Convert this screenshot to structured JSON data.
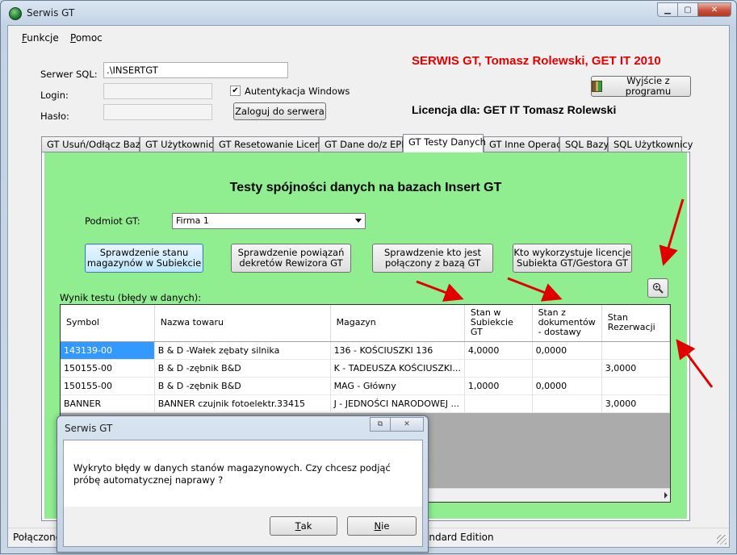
{
  "window": {
    "title": "Serwis GT",
    "controls": [
      "▁",
      "▢",
      "✕"
    ]
  },
  "menu": [
    {
      "accel": "F",
      "rest": "unkcje"
    },
    {
      "accel": "P",
      "rest": "omoc"
    }
  ],
  "connection": {
    "server_label": "Serwer SQL:",
    "server_value": ".\\INSERTGT",
    "login_label": "Login:",
    "login_value": "",
    "password_label": "Hasło:",
    "password_value": "",
    "windows_auth_label": "Autentykacja Windows",
    "windows_auth_checked": true,
    "connect_button": "Zaloguj do serwera"
  },
  "header": {
    "title": "SERWIS GT, Tomasz Rolewski, GET IT 2010",
    "license": "Licencja dla: GET IT Tomasz Rolewski",
    "exit_button": "Wyjście z programu",
    "title_color": "#e30000"
  },
  "tabs": [
    "GT Usuń/Odłącz Bazy",
    "GT Użytkownicy",
    "GT Resetowanie Licencji",
    "GT Dane do/z EPP",
    "GT Testy Danych",
    "GT Inne Operacje",
    "SQL Bazy",
    "SQL Użytkownicy"
  ],
  "active_tab": "GT Testy Danych",
  "panel": {
    "heading": "Testy spójności danych na bazach Insert GT",
    "subject_label": "Podmiot GT:",
    "subject_value": "Firma 1",
    "buttons": [
      "Sprawdzenie stanu magazynów w Subiekcie",
      "Sprawdzenie powiązań dekretów Rewizora GT",
      "Sprawdzenie kto jest połączony z bazą GT",
      "Kto wykorzystuje licencje Subiekta GT/Gestora GT"
    ],
    "result_label": "Wynik testu (błędy w danych):",
    "background_color": "#90ee90"
  },
  "grid": {
    "columns": [
      "Symbol",
      "Nazwa towaru",
      "Magazyn",
      "Stan w Subiekcie GT",
      "Stan z dokumentów - dostawy",
      "Stan Rezerwacji"
    ],
    "rows": [
      [
        "143139-00",
        "B & D -Wałek zębaty silnika",
        "136 - KOŚCIUSZKI  136",
        "4,0000",
        "0,0000",
        ""
      ],
      [
        "150155-00",
        "B & D -zębnik B&D",
        "K - TADEUSZA KOŚCIUSZKI...",
        "",
        "",
        "3,0000"
      ],
      [
        "150155-00",
        "B & D -zębnik B&D",
        "MAG - Główny",
        "1,0000",
        "0,0000",
        ""
      ],
      [
        "BANNER",
        "BANNER czujnik fotoelektr.33415",
        "J - JEDNOŚCI NARODOWEJ ...",
        "",
        "",
        "3,0000"
      ]
    ]
  },
  "status": {
    "left": "Połączono",
    "right": "andard Edition"
  },
  "dialog": {
    "title": "Serwis GT",
    "message": "Wykryto błędy w danych stanów magazynowych. Czy chcesz podjąć próbę automatycznej naprawy ?",
    "yes_accel": "T",
    "yes_rest": "ak",
    "no_accel": "N",
    "no_rest": "ie"
  }
}
